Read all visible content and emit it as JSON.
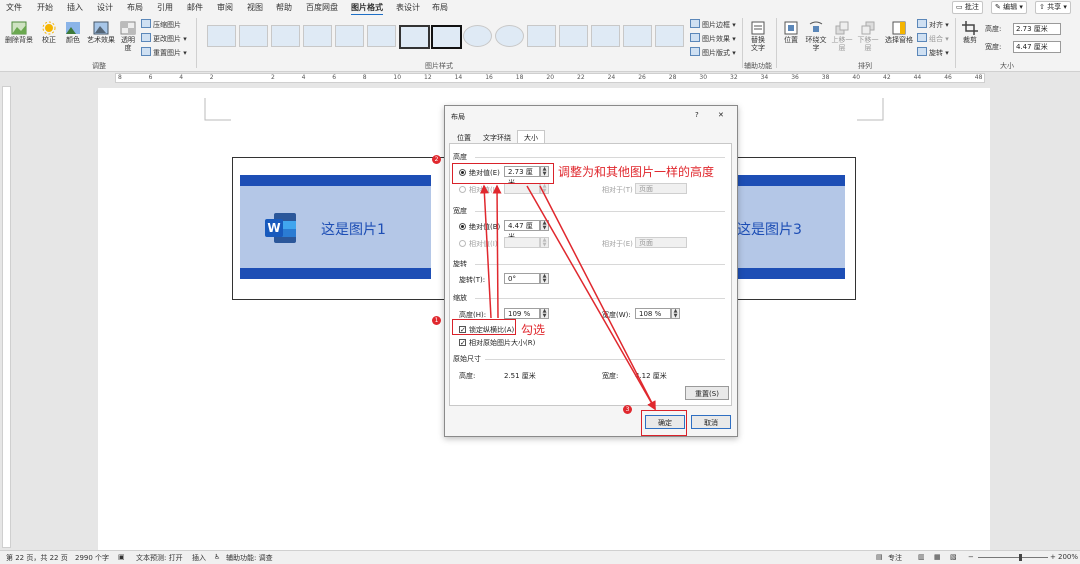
{
  "menu": {
    "tabs": [
      "文件",
      "开始",
      "插入",
      "设计",
      "布局",
      "引用",
      "邮件",
      "审阅",
      "视图",
      "帮助",
      "百度网盘",
      "图片格式",
      "表设计",
      "布局"
    ],
    "active_tab": "图片格式",
    "comment_label": "批注",
    "edit_label": "编辑",
    "share_label": "共享"
  },
  "ribbon": {
    "remove_bg": "删除背景",
    "correct": "校正",
    "color": "颜色",
    "art_effect": "艺术效果",
    "transparency": "透明度",
    "compress": "压缩图片",
    "change_pic": "更改图片",
    "reset_pic": "重置图片",
    "group_adjust": "调整",
    "pic_border": "图片边框",
    "pic_effect": "图片效果",
    "pic_layout": "图片版式",
    "group_style": "图片样式",
    "alt_text": "替换文字",
    "group_access": "辅助功能",
    "position": "位置",
    "wrap_text": "环绕文字",
    "bring_forward": "上移一层",
    "send_backward": "下移一层",
    "selection_pane": "选择窗格",
    "align": "对齐",
    "group": "组合",
    "rotate": "旋转",
    "group_arrange": "排列",
    "crop": "裁剪",
    "height_label": "高度:",
    "height_value": "2.73 厘米",
    "width_label": "宽度:",
    "width_value": "4.47 厘米",
    "group_size": "大小"
  },
  "ruler": {
    "ticks": [
      "8",
      "6",
      "4",
      "2",
      "",
      "2",
      "4",
      "6",
      "8",
      "10",
      "12",
      "14",
      "16",
      "18",
      "20",
      "22",
      "24",
      "26",
      "28",
      "30",
      "32",
      "34",
      "36",
      "38",
      "40",
      "42",
      "44",
      "46",
      "48"
    ]
  },
  "document": {
    "image1_text": "这是图片1",
    "image3_text": "这是图片3",
    "word_logo": "W"
  },
  "dialog": {
    "title": "布局",
    "help": "?",
    "close": "✕",
    "tabs": [
      "位置",
      "文字环绕",
      "大小"
    ],
    "active_tab": "大小",
    "height_section": "高度",
    "abs_label": "绝对值(E)",
    "height_abs_value": "2.73 厘米",
    "rel_label": "相对值(L)",
    "relative_to": "相对于(T)",
    "page_option": "页面",
    "width_section": "宽度",
    "width_abs_label": "绝对值(B)",
    "width_abs_value": "4.47 厘米",
    "width_rel_label": "相对值(I)",
    "width_relative_to": "相对于(E)",
    "rotate_section": "旋转",
    "rotate_label": "旋转(T):",
    "rotate_value": "0°",
    "scale_section": "缩放",
    "scale_h_label": "高度(H):",
    "scale_h_value": "109 %",
    "scale_w_label": "宽度(W):",
    "scale_w_value": "108 %",
    "lock_ratio": "锁定纵横比(A)",
    "relative_original": "相对原始图片大小(R)",
    "original_section": "原始尺寸",
    "orig_h_label": "高度:",
    "orig_h_value": "2.51 厘米",
    "orig_w_label": "宽度:",
    "orig_w_value": "4.12 厘米",
    "reset": "重置(S)",
    "ok": "确定",
    "cancel": "取消"
  },
  "annotations": {
    "badge1": "1",
    "badge2": "2",
    "badge3": "3",
    "note_height": "调整为和其他图片一样的高度",
    "note_check": "勾选",
    "color": "#e0282e"
  },
  "status": {
    "page": "第 22 页，共 22 页",
    "words": "2990 个字",
    "text_predict": "文本预测: 打开",
    "insert": "插入",
    "accessibility": "辅助功能: 调查",
    "focus": "专注",
    "zoom": "200%"
  }
}
